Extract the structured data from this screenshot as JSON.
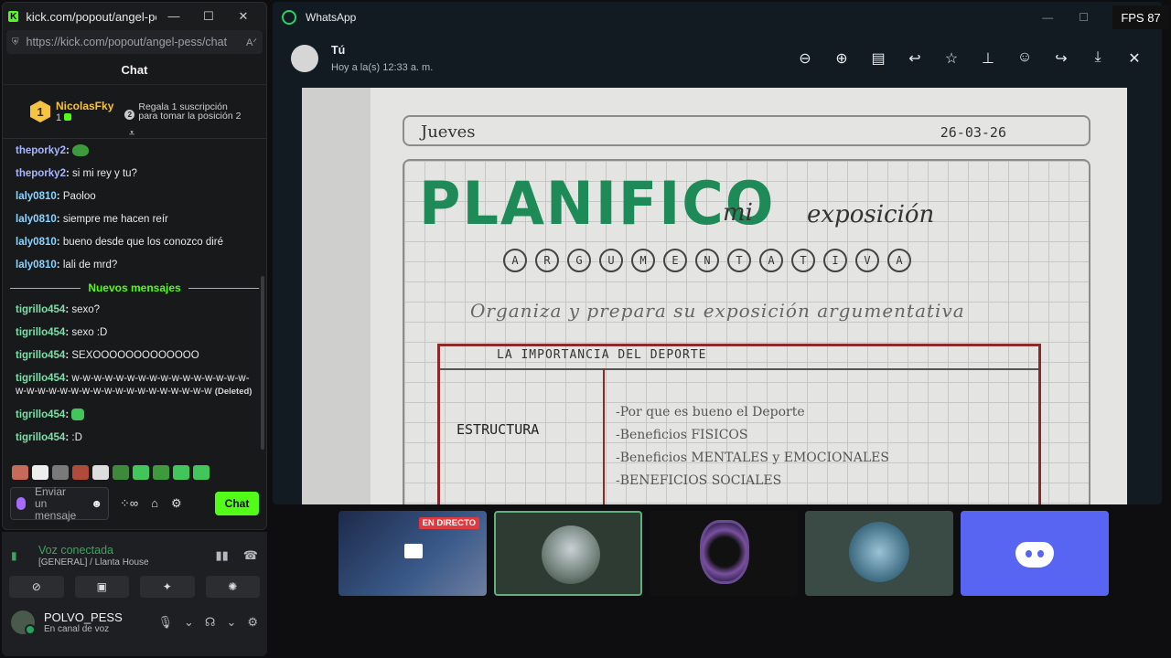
{
  "kick": {
    "window_title": "kick.com/popout/angel-pes...",
    "url": "https://kick.com/popout/angel-pess/chat",
    "chat_title": "Chat",
    "pinned": {
      "rank": "1",
      "top_user": "NicolasFky",
      "top_count": "1",
      "gift_rank": "2",
      "gift_text": "Regala 1 suscripción para tomar la posición 2"
    },
    "messages_before": [
      {
        "user": "theporky2",
        "text": "",
        "emote": true
      },
      {
        "user": "theporky2",
        "text": "si mi rey y tu?"
      },
      {
        "user": "laly0810",
        "text": "Paoloo"
      },
      {
        "user": "laly0810",
        "text": "siempre me hacen reír"
      },
      {
        "user": "laly0810",
        "text": "bueno desde que los conozco diré"
      },
      {
        "user": "laly0810",
        "text": "lali de mrd?"
      }
    ],
    "new_messages_label": "Nuevos mensajes",
    "messages_after": [
      {
        "user": "tigrillo454",
        "text": "sexo?"
      },
      {
        "user": "tigrillo454",
        "text": "sexo :D"
      },
      {
        "user": "tigrillo454",
        "text": "SEXOOOOOOOOOOOOO"
      },
      {
        "user": "tigrillo454",
        "text": "w-w-w-w-w-w-w-w-w-w-w-w-w-w-w-w-w-w-w-w-w-w-w-w-w-w-w-w-w-w-w-w-w-w",
        "deleted": "(Deleted)"
      },
      {
        "user": "tigrillo454",
        "text": "",
        "emote": true
      },
      {
        "user": "tigrillo454",
        "text": ":D"
      }
    ],
    "input_placeholder": "Enviar un mensaje",
    "chat_button": "Chat"
  },
  "discord": {
    "voice_status": "Voz conectada",
    "voice_channel": "[GENERAL] / Llanta House",
    "username": "POLVO_PESS",
    "user_status": "En canal de voz"
  },
  "whatsapp": {
    "app_title": "WhatsApp",
    "sender": "Tú",
    "time": "Hoy a la(s) 12:33 a. m.",
    "photo": {
      "day": "Jueves",
      "date": "26-03-26",
      "title": "PLANIFICO",
      "mi": "mi",
      "exposicion": "exposición",
      "letters": [
        "A",
        "R",
        "G",
        "U",
        "M",
        "E",
        "N",
        "T",
        "A",
        "T",
        "I",
        "V",
        "A"
      ],
      "instruction": "Organiza y prepara su exposición argumentativa",
      "table_title": "LA IMPORTANCIA DEL DEPORTE",
      "row_label": "ESTRUCTURA",
      "lines": [
        "-Por que es bueno el Deporte",
        "-Beneficios FISICOS",
        "-Beneficios MENTALES y EMOCIONALES",
        "-BENEFICIOS SOCIALES"
      ]
    }
  },
  "taskbar": {
    "live_label": "EN DIRECTO"
  },
  "fps": "FPS 87"
}
